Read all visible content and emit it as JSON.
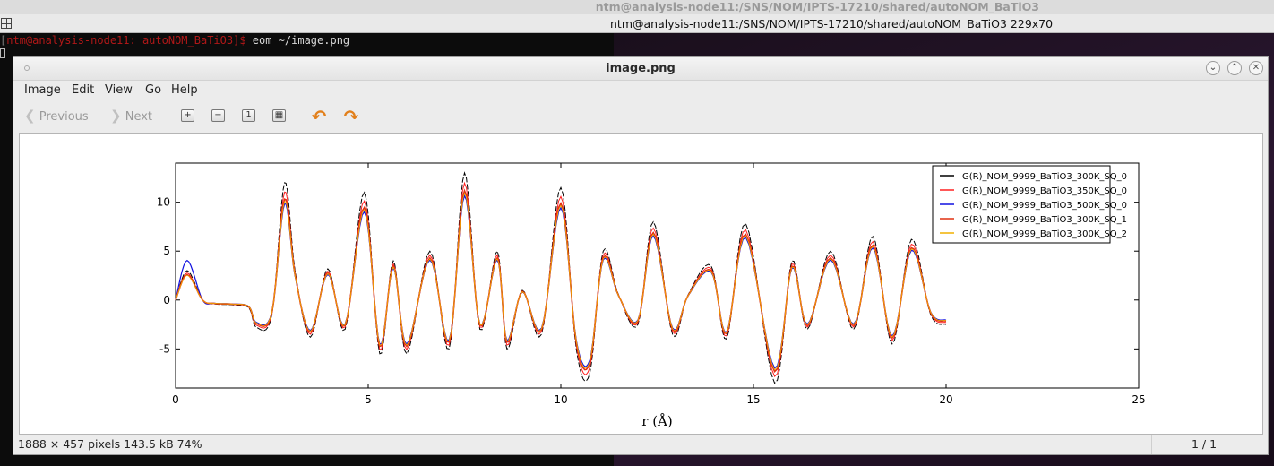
{
  "desktop": {
    "top_title": "ntm@analysis-node11:/SNS/NOM/IPTS-17210/shared/autoNOM_BaTiO3",
    "terminal_title": "ntm@analysis-node11:/SNS/NOM/IPTS-17210/shared/autoNOM_BaTiO3 229x70",
    "terminal_prompt": "ntm@analysis-node11: autoNOM_BaTiO3]$",
    "terminal_command": " eom ~/image.png"
  },
  "window": {
    "title": "image.png",
    "menu": [
      "Image",
      "Edit",
      "View",
      "Go",
      "Help"
    ],
    "toolbar": {
      "previous": "Previous",
      "next": "Next"
    },
    "status_left": "1888 × 457 pixels  143.5 kB    74%",
    "status_right": "1 / 1"
  },
  "colors": {
    "series_black": "#000000",
    "series_red": "#ff2020",
    "series_blue": "#1010e0",
    "series_darkred": "#e03010",
    "series_yellow": "#f0b000"
  },
  "chart_data": {
    "type": "line",
    "xlabel": "r (Å)",
    "ylabel": "",
    "xlim": [
      0,
      25
    ],
    "ylim": [
      -9,
      14
    ],
    "xticks": [
      0,
      5,
      10,
      15,
      20,
      25
    ],
    "yticks": [
      -5,
      0,
      5,
      10
    ],
    "legend": "top-right",
    "series": [
      {
        "name": "G(R)_NOM_9999_BaTiO3_300K_SQ_0",
        "color": "#000000"
      },
      {
        "name": "G(R)_NOM_9999_BaTiO3_350K_SQ_0",
        "color": "#ff2020"
      },
      {
        "name": "G(R)_NOM_9999_BaTiO3_500K_SQ_0",
        "color": "#1010e0"
      },
      {
        "name": "G(R)_NOM_9999_BaTiO3_300K_SQ_1",
        "color": "#e03010"
      },
      {
        "name": "G(R)_NOM_9999_BaTiO3_300K_SQ_2",
        "color": "#f0b000"
      }
    ],
    "key_points_300K": {
      "x": [
        0.0,
        0.3,
        0.7,
        1.0,
        1.5,
        1.9,
        2.1,
        2.5,
        2.83,
        3.1,
        3.5,
        3.95,
        4.4,
        4.9,
        5.3,
        5.65,
        6.0,
        6.6,
        7.1,
        7.5,
        7.9,
        8.35,
        8.6,
        9.0,
        9.5,
        10.0,
        10.4,
        10.75,
        11.1,
        11.5,
        12.0,
        12.4,
        12.9,
        13.3,
        13.9,
        14.3,
        14.8,
        15.55,
        16.0,
        16.4,
        17.0,
        17.6,
        18.1,
        18.6,
        19.1,
        19.6,
        20.0
      ],
      "y": [
        0.0,
        3.0,
        0.0,
        -0.4,
        -0.5,
        -0.8,
        -2.8,
        -1.5,
        12.0,
        3.0,
        -3.8,
        3.2,
        -3.0,
        11.0,
        -5.5,
        4.0,
        -5.5,
        5.0,
        -5.0,
        13.0,
        -3.0,
        5.0,
        -5.0,
        1.0,
        -3.5,
        11.5,
        -5.0,
        -7.5,
        5.0,
        0.5,
        -2.5,
        8.0,
        -3.5,
        0.5,
        3.5,
        -4.0,
        7.8,
        -8.5,
        4.0,
        -3.0,
        5.0,
        -3.0,
        6.5,
        -4.5,
        6.2,
        -1.5,
        -2.5
      ]
    }
  }
}
